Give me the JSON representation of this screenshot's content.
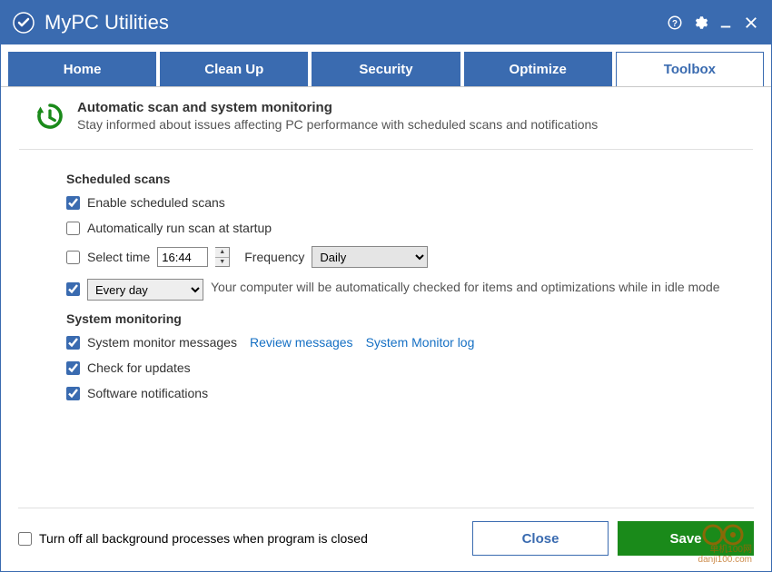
{
  "app": {
    "title": "MyPC Utilities"
  },
  "tabs": [
    {
      "label": "Home",
      "active": false
    },
    {
      "label": "Clean Up",
      "active": false
    },
    {
      "label": "Security",
      "active": false
    },
    {
      "label": "Optimize",
      "active": false
    },
    {
      "label": "Toolbox",
      "active": true
    }
  ],
  "header": {
    "title": "Automatic scan and system monitoring",
    "subtitle": "Stay informed about issues affecting PC performance with scheduled scans and notifications"
  },
  "sections": {
    "scheduled": {
      "title": "Scheduled scans",
      "enable_label": "Enable scheduled scans",
      "startup_label": "Automatically run scan at startup",
      "select_time_label": "Select time",
      "time_value": "16:44",
      "frequency_label": "Frequency",
      "frequency_value": "Daily",
      "day_value": "Every day",
      "idle_text": "Your computer will be automatically checked for items and optimizations while in idle mode"
    },
    "monitoring": {
      "title": "System monitoring",
      "messages_label": "System monitor messages",
      "review_link": "Review messages",
      "log_link": "System Monitor log",
      "updates_label": "Check for updates",
      "notifications_label": "Software notifications"
    }
  },
  "footer": {
    "turnoff_label": "Turn off all background processes when program is closed",
    "close_label": "Close",
    "save_label": "Save"
  },
  "watermark": {
    "line1": "单机100网",
    "line2": "danji100.com"
  }
}
